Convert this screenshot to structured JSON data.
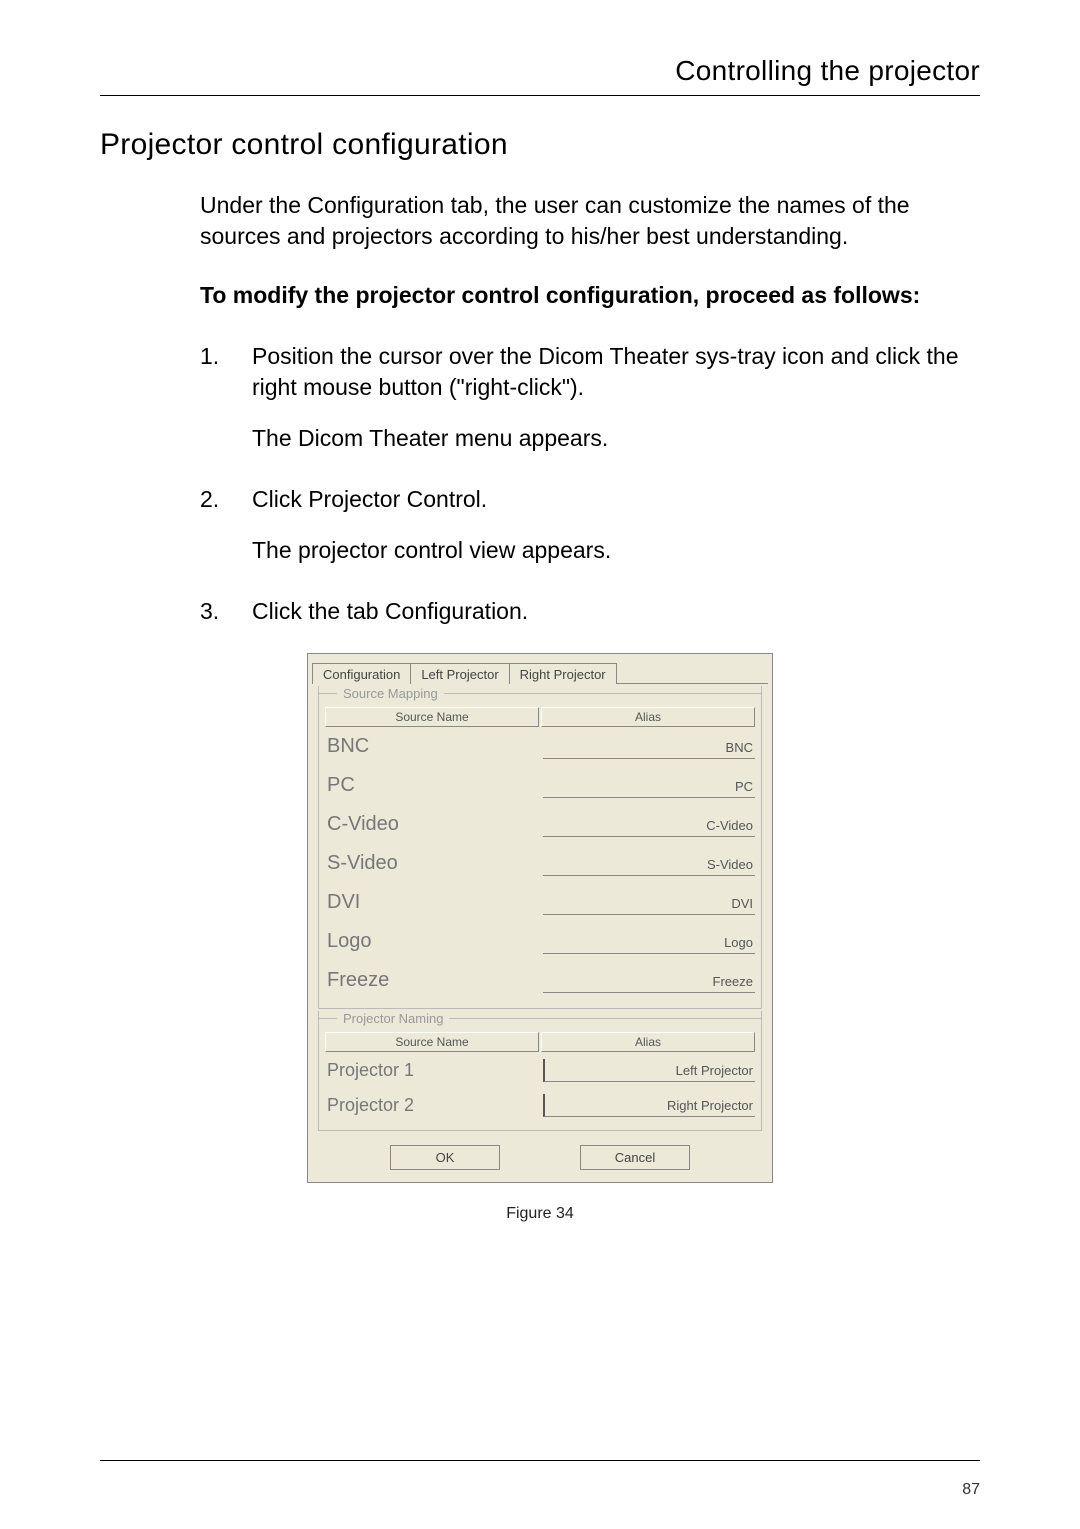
{
  "running_header": "Controlling the projector",
  "section_title": "Projector control configuration",
  "intro": "Under the Configuration tab, the user can customize the names of the sources and projectors according to his/her best understanding.",
  "subhead": "To modify the projector control configuration, proceed as follows:",
  "steps": [
    {
      "num": "1.",
      "text": "Position the cursor over the Dicom Theater sys-tray icon and click the right mouse button (\"right-click\").",
      "sub": "The Dicom Theater menu appears."
    },
    {
      "num": "2.",
      "text": "Click Projector Control.",
      "sub": "The projector control view appears."
    },
    {
      "num": "3.",
      "text": "Click the tab Configuration.",
      "sub": ""
    }
  ],
  "dialog": {
    "tabs": {
      "t1": "Configuration",
      "t2": "Left Projector",
      "t3": "Right Projector"
    },
    "group1": {
      "legend": "Source Mapping",
      "hdr_name": "Source Name",
      "hdr_alias": "Alias",
      "rows": [
        {
          "name": "BNC",
          "alias": "BNC"
        },
        {
          "name": "PC",
          "alias": "PC"
        },
        {
          "name": "C-Video",
          "alias": "C-Video"
        },
        {
          "name": "S-Video",
          "alias": "S-Video"
        },
        {
          "name": "DVI",
          "alias": "DVI"
        },
        {
          "name": "Logo",
          "alias": "Logo"
        },
        {
          "name": "Freeze",
          "alias": "Freeze"
        }
      ]
    },
    "group2": {
      "legend": "Projector Naming",
      "hdr_name": "Source Name",
      "hdr_alias": "Alias",
      "rows": [
        {
          "name": "Projector 1",
          "alias": "Left Projector"
        },
        {
          "name": "Projector 2",
          "alias": "Right Projector"
        }
      ]
    },
    "ok": "OK",
    "cancel": "Cancel"
  },
  "fig_caption": "Figure 34",
  "page_num": "87"
}
